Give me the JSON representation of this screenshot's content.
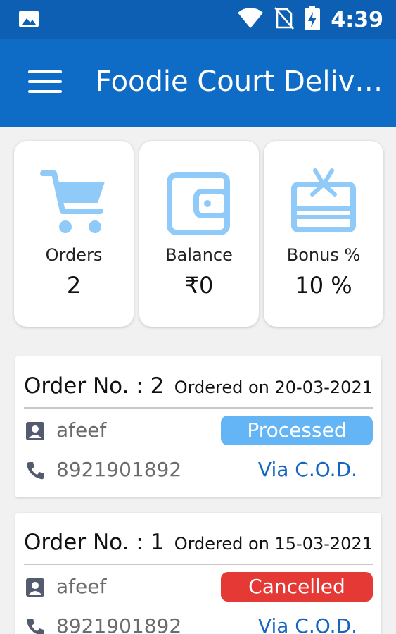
{
  "status_bar": {
    "time": "4:39",
    "icons": [
      "image-icon",
      "wifi-icon",
      "no-sim-icon",
      "battery-charging-icon"
    ]
  },
  "app_bar": {
    "title": "Foodie Court Deliv…",
    "menu_icon": "hamburger-menu-icon"
  },
  "stats": [
    {
      "label": "Orders",
      "value": "2",
      "icon": "cart-icon",
      "icon_color": "#90caf9"
    },
    {
      "label": "Balance",
      "value": "₹0",
      "icon": "wallet-icon",
      "icon_color": "#90caf9"
    },
    {
      "label": "Bonus %",
      "value": "10 %",
      "icon": "gift-card-icon",
      "icon_color": "#90caf9"
    }
  ],
  "orders": [
    {
      "order_no": "Order No. : 2",
      "date": "Ordered on 20-03-2021",
      "customer": "afeef",
      "phone": "8921901892",
      "status": "Processed",
      "status_color": "#64b5f6",
      "payment": "Via C.O.D."
    },
    {
      "order_no": "Order No. : 1",
      "date": "Ordered on 15-03-2021",
      "customer": "afeef",
      "phone": "8921901892",
      "status": "Cancelled",
      "status_color": "#e53935",
      "payment": "Via C.O.D."
    }
  ]
}
